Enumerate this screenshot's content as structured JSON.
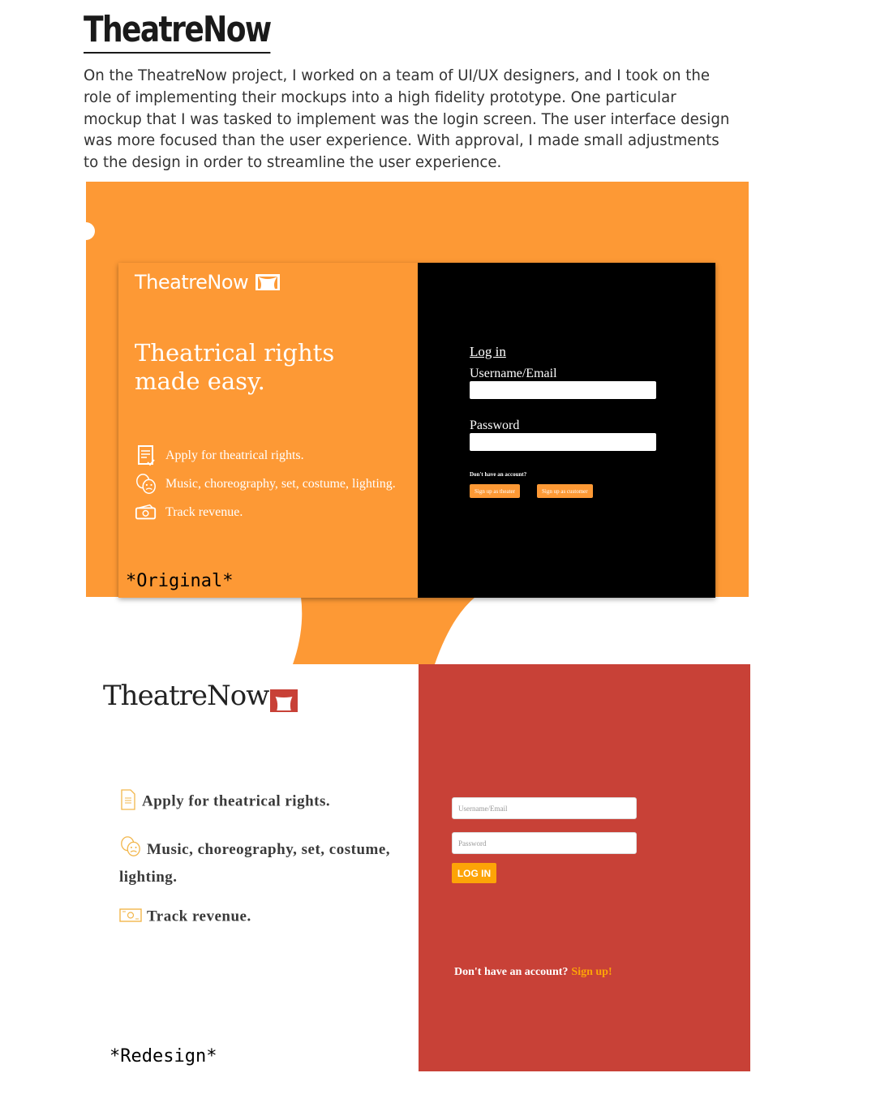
{
  "header": {
    "title": "TheatreNow",
    "intro": "On the TheatreNow project, I worked on a team of UI/UX designers, and I took on the role of implementing their mockups into a high fidelity prototype. One particular mockup that I was tasked to implement was the login screen. The user interface design was more focused than the user experience. With approval, I made small adjustments to the design in order to streamline the user experience."
  },
  "original": {
    "logo_text": "TheatreNow",
    "headline_line1": "Theatrical rights",
    "headline_line2": "made easy.",
    "features": [
      {
        "icon": "document-check-icon",
        "label": "Apply for theatrical rights."
      },
      {
        "icon": "theatre-masks-icon",
        "label": "Music, choreography, set, costume, lighting."
      },
      {
        "icon": "money-icon",
        "label": "Track revenue."
      }
    ],
    "tag": "*Original*",
    "login_title": "Log in",
    "username_label": "Username/Email",
    "password_label": "Password",
    "no_account": "Don't have an account?",
    "signup_theater": "Sign up as theater",
    "signup_customer": "Sign up as customer"
  },
  "redesign": {
    "logo_text": "TheatreNow",
    "features": [
      {
        "icon": "document-icon",
        "label": "Apply for theatrical rights."
      },
      {
        "icon": "theatre-masks-icon",
        "label_line1": "Music, choreography, set, costume,",
        "label_line2": "lighting."
      },
      {
        "icon": "money-icon",
        "label": "Track revenue."
      }
    ],
    "tag": "*Redesign*",
    "username_placeholder": "Username/Email",
    "password_placeholder": "Password",
    "login_button": "LOG IN",
    "no_account": "Don't have an account?",
    "signup_link": "Sign up!"
  },
  "colors": {
    "orange": "#fd9935",
    "black": "#000000",
    "red": "#c84137",
    "yellow": "#fda407"
  }
}
